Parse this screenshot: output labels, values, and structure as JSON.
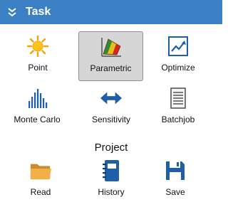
{
  "panel": {
    "title": "Task",
    "header_color": "#3b7fc4"
  },
  "tools": [
    {
      "label": "Point",
      "icon": "sun-icon"
    },
    {
      "label": "Parametric",
      "icon": "surface-plot-icon",
      "selected": true
    },
    {
      "label": "Optimize",
      "icon": "trend-chart-icon"
    },
    {
      "label": "Monte Carlo",
      "icon": "histogram-icon"
    },
    {
      "label": "Sensitivity",
      "icon": "double-arrow-icon"
    },
    {
      "label": "Batchjob",
      "icon": "document-lines-icon"
    }
  ],
  "project": {
    "heading": "Project",
    "items": [
      {
        "label": "Read",
        "icon": "folder-icon"
      },
      {
        "label": "History",
        "icon": "notebook-icon"
      },
      {
        "label": "Save",
        "icon": "floppy-disk-icon"
      }
    ]
  }
}
